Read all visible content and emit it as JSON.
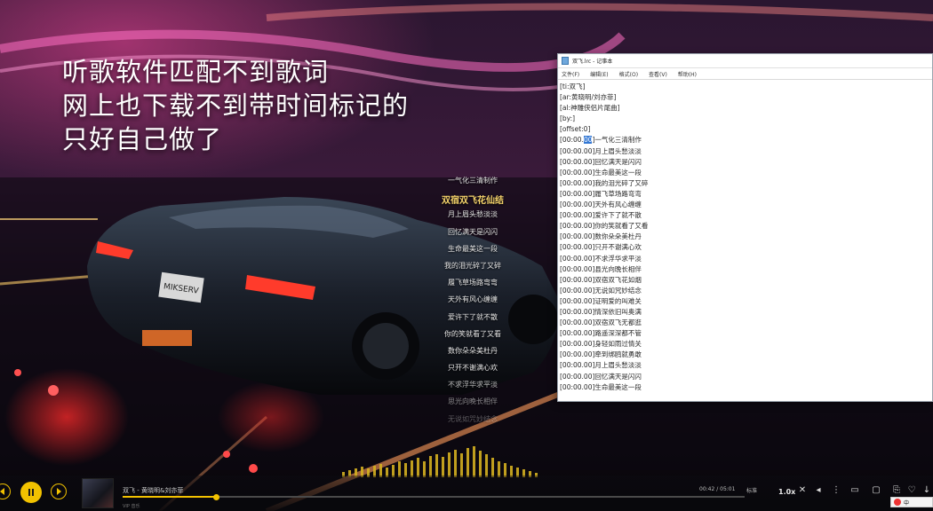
{
  "caption": {
    "lines": [
      "听歌软件匹配不到歌词",
      "网上也下载不到带时间标记的",
      "只好自己做了"
    ]
  },
  "lyrics_overlay": {
    "lines": [
      "一气化三清制作",
      "双宿双飞花仙结",
      "月上眉头愁淡淡",
      "回忆满天是闪闪",
      "生命最美这一段",
      "我的泪光碎了又碎",
      "履飞草场路弯弯",
      "天外有风心缠缠",
      "爱许下了就不散",
      "你的笑就看了又看",
      "数你朵朵美杜丹",
      "只开不谢满心欢",
      "不求浮华求平淡",
      "思光向晚长相伴",
      "无说如咒妙结念"
    ],
    "active_index": 1
  },
  "notepad": {
    "title": "双飞.lrc - 记事本",
    "menu": [
      "文件(F)",
      "编辑(E)",
      "格式(O)",
      "查看(V)",
      "帮助(H)"
    ],
    "header_lines": [
      "[ti:双飞]",
      "[ar:黄晓明/刘亦菲]",
      "[al:神雕侠侣片尾曲]",
      "[by:]",
      "[offset:0]"
    ],
    "timestamp": "00:00.00",
    "selected_text": "00",
    "lyric_lines": [
      "一气化三清制作",
      "月上眉头愁淡淡",
      "回忆满天是闪闪",
      "生命最美这一段",
      "我的泪光碎了又碎",
      "履飞草场路弯弯",
      "天外有风心缠缠",
      "爱许下了就不散",
      "你的笑就看了又看",
      "数你朵朵美杜丹",
      "只开不谢满心欢",
      "不求浮华求平淡",
      "县光向晚长相伴",
      "双宿双飞花如烟",
      "无说如咒妙结念",
      "证明爱的叫难关",
      "情深依旧叫奥满",
      "双宿双飞无都逛",
      "路遥深深都不管",
      "身轻如雨过情关",
      "牵到绑鸥就勇敢",
      "月上眉头愁淡淡",
      "回忆满天是闪闪",
      "生命最美这一段"
    ]
  },
  "player": {
    "song": "双飞 - 黄晓明&刘亦菲",
    "sub": "VIP 音乐",
    "time": "00:42 / 05:01",
    "quality": "标准",
    "speed": "1.0x",
    "progress": 0.15,
    "accent": "#f2c200"
  },
  "ime": {
    "label": "中"
  }
}
